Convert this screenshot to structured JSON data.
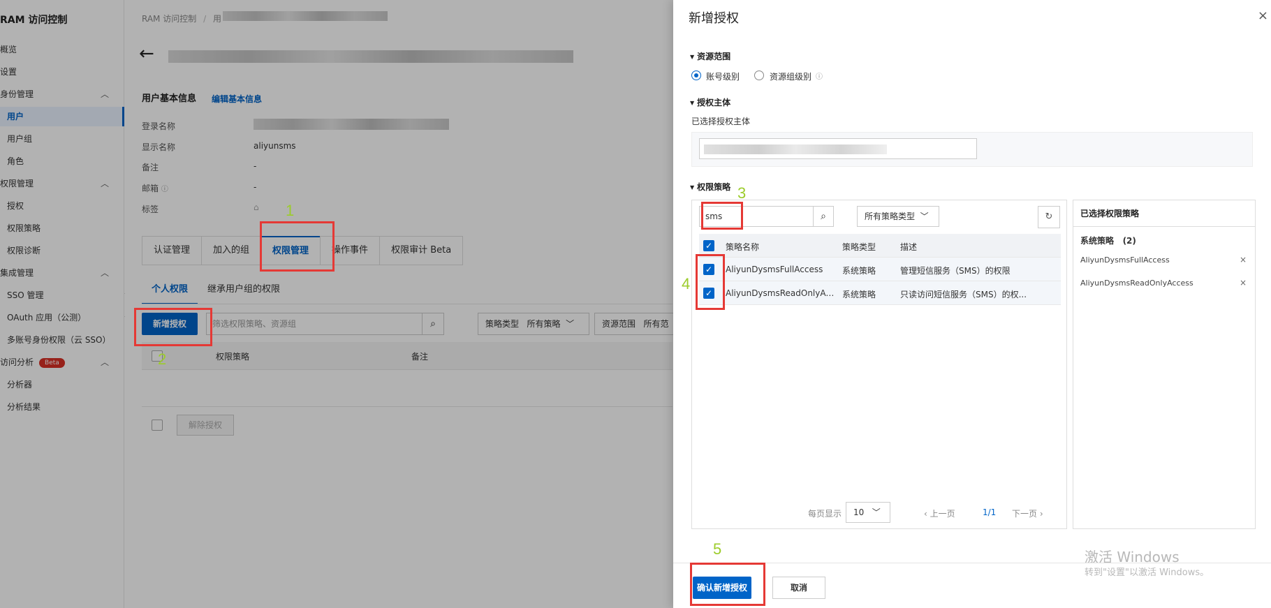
{
  "sidebar": {
    "title": "RAM 访问控制",
    "items": [
      {
        "label": "概览"
      },
      {
        "label": "设置"
      },
      {
        "label": "身份管理"
      },
      {
        "label": "用户"
      },
      {
        "label": "用户组"
      },
      {
        "label": "角色"
      },
      {
        "label": "权限管理"
      },
      {
        "label": "授权"
      },
      {
        "label": "权限策略"
      },
      {
        "label": "权限诊断"
      },
      {
        "label": "集成管理"
      },
      {
        "label": "SSO 管理"
      },
      {
        "label": "OAuth 应用（公测）"
      },
      {
        "label": "多账号身份权限（云 SSO）"
      },
      {
        "label": "访问分析",
        "badge": "Beta"
      },
      {
        "label": "分析器"
      },
      {
        "label": "分析结果"
      }
    ]
  },
  "main": {
    "breadcrumb": [
      "RAM 访问控制",
      "/",
      "用"
    ],
    "basic_info_title": "用户基本信息",
    "edit_link": "编辑基本信息",
    "fields": [
      {
        "label": "登录名称",
        "value": ""
      },
      {
        "label": "显示名称",
        "value": "aliyunsms"
      },
      {
        "label": "备注",
        "value": "-"
      },
      {
        "label": "邮箱",
        "value": "-"
      },
      {
        "label": "标签",
        "value": ""
      }
    ],
    "tabs": [
      "认证管理",
      "加入的组",
      "权限管理",
      "操作事件",
      "权限审计 Beta"
    ],
    "subtabs": [
      "个人权限",
      "继承用户组的权限"
    ],
    "add_button": "新增授权",
    "filter_placeholder": "筛选权限策略、资源组",
    "policy_type_label": "策略类型",
    "policy_type_value": "所有策略",
    "resource_scope_label": "资源范围",
    "resource_scope_value": "所有范",
    "table_headers": [
      "权限策略",
      "备注"
    ],
    "revoke_button": "解除授权"
  },
  "drawer": {
    "title": "新增授权",
    "close": "×",
    "resource_scope": {
      "title": "资源范围",
      "options": [
        "账号级别",
        "资源组级别"
      ]
    },
    "principal": {
      "title": "授权主体",
      "selected_label": "已选择授权主体"
    },
    "policy": {
      "title": "权限策略",
      "search_value": "sms",
      "type_select": "所有策略类型",
      "headers": [
        "策略名称",
        "策略类型",
        "描述"
      ],
      "rows": [
        {
          "name": "AliyunDysmsFullAccess",
          "type": "系统策略",
          "desc": "管理短信服务（SMS）的权限"
        },
        {
          "name": "AliyunDysmsReadOnlyAccess",
          "type": "系统策略",
          "desc": "只读访问短信服务（SMS）的权..."
        }
      ],
      "page_size_label": "每页显示",
      "page_size": "10",
      "prev": "上一页",
      "page": "1/1",
      "next": "下一页"
    },
    "selected": {
      "title": "已选择权限策略",
      "group": "系统策略",
      "count": "(2)",
      "items": [
        "AliyunDysmsFullAccess",
        "AliyunDysmsReadOnlyAccess"
      ]
    },
    "confirm_button": "确认新增授权",
    "cancel_button": "取消",
    "watermark_line1": "激活 Windows",
    "watermark_line2": "转到\"设置\"以激活 Windows。"
  },
  "annotations": [
    "1",
    "2",
    "3",
    "4",
    "5"
  ],
  "colors": {
    "accent": "#0064c8",
    "annotation_box": "#e53935",
    "annotation_text": "#9ccc2b"
  }
}
